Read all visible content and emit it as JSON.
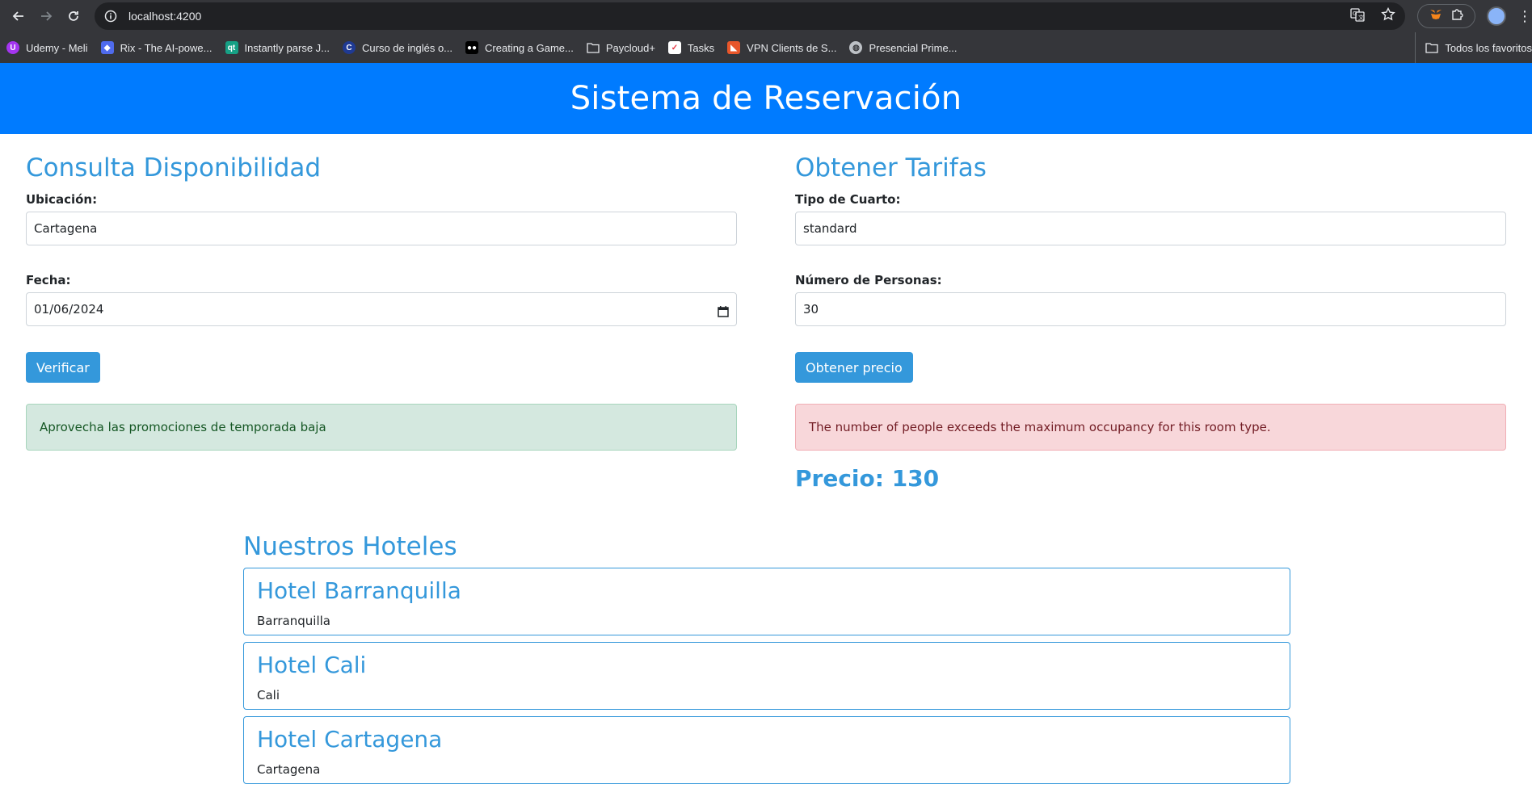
{
  "browser": {
    "url": "localhost:4200",
    "bookmarks": [
      {
        "label": "Udemy - Meli",
        "icon": "udemy-icon",
        "color": "#a435f0"
      },
      {
        "label": "Rix - The AI-powe...",
        "icon": "rix-icon",
        "color": "#4f6bed"
      },
      {
        "label": "Instantly parse J...",
        "icon": "qt-icon",
        "color": "#16a085"
      },
      {
        "label": "Curso de inglés o...",
        "icon": "c-icon",
        "color": "#1f3a93"
      },
      {
        "label": "Creating a Game...",
        "icon": "medium-icon",
        "color": "#000000"
      },
      {
        "label": "Paycloud+",
        "icon": "folder-icon",
        "color": "#e8eaed"
      },
      {
        "label": "Tasks",
        "icon": "tasks-icon",
        "color": "#ffffff"
      },
      {
        "label": "VPN Clients de S...",
        "icon": "vpn-icon",
        "color": "#e8562a"
      },
      {
        "label": "Presencial Prime...",
        "icon": "globe-icon",
        "color": "#bdc1c6"
      }
    ],
    "all_bookmarks_label": "Todos los favoritos"
  },
  "header": {
    "title": "Sistema de Reservación"
  },
  "availability": {
    "title": "Consulta Disponibilidad",
    "location_label": "Ubicación:",
    "location_value": "Cartagena",
    "date_label": "Fecha:",
    "date_value": "01/06/2024",
    "button_label": "Verificar",
    "message": "Aprovecha las promociones de temporada baja"
  },
  "rates": {
    "title": "Obtener Tarifas",
    "room_type_label": "Tipo de Cuarto:",
    "room_type_value": "standard",
    "people_label": "Número de Personas:",
    "people_value": "30",
    "button_label": "Obtener precio",
    "error_message": "The number of people exceeds the maximum occupancy for this room type.",
    "price_text": "Precio: 130"
  },
  "hotels": {
    "title": "Nuestros Hoteles",
    "items": [
      {
        "name": "Hotel Barranquilla",
        "city": "Barranquilla"
      },
      {
        "name": "Hotel Cali",
        "city": "Cali"
      },
      {
        "name": "Hotel Cartagena",
        "city": "Cartagena"
      }
    ]
  },
  "colors": {
    "header_bg": "#007bff",
    "accent": "#3498db",
    "success_bg": "#d4e8df",
    "danger_bg": "#f8d7da"
  }
}
